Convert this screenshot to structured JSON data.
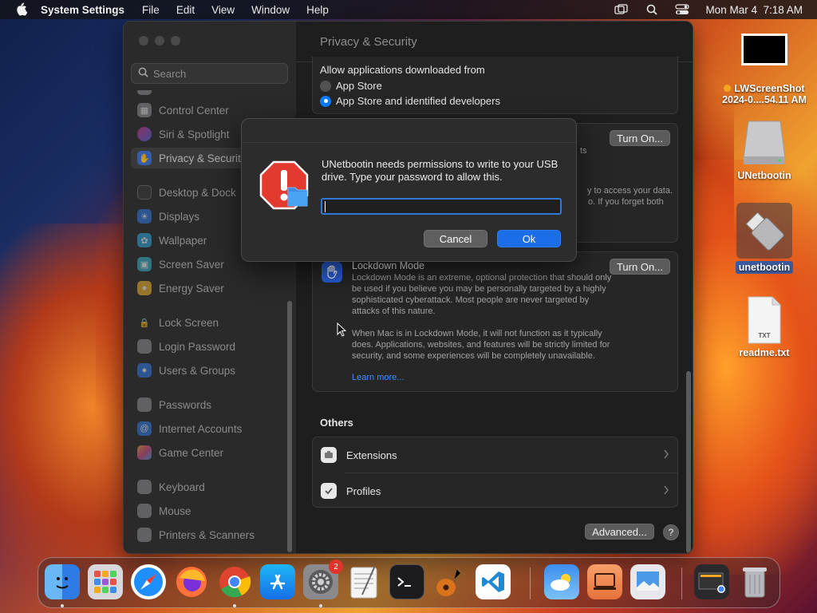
{
  "menubar": {
    "app_name": "System Settings",
    "menus": [
      "File",
      "Edit",
      "View",
      "Window",
      "Help"
    ],
    "clock": "Mon Mar 4  7:18 AM",
    "icons": [
      "apple-icon",
      "screen-mirroring-icon",
      "spotlight-search-icon",
      "control-center-icon"
    ]
  },
  "sidebar": {
    "search_placeholder": "Search",
    "items": [
      {
        "label": "Control Center",
        "icon": "control-center-icon",
        "color": "#8e8e93"
      },
      {
        "label": "Siri & Spotlight",
        "icon": "siri-icon",
        "color": "#c2409a"
      },
      {
        "label": "Privacy & Security",
        "icon": "hand-icon",
        "color": "#3a6fd8"
      },
      {
        "label": "Desktop & Dock",
        "icon": "dock-icon",
        "color": "#2b2b2b"
      },
      {
        "label": "Displays",
        "icon": "displays-icon",
        "color": "#2f7ae5"
      },
      {
        "label": "Wallpaper",
        "icon": "wallpaper-icon",
        "color": "#2fa8d8"
      },
      {
        "label": "Screen Saver",
        "icon": "screen-saver-icon",
        "color": "#37b3c9"
      },
      {
        "label": "Energy Saver",
        "icon": "energy-icon",
        "color": "#f0b32c"
      },
      {
        "label": "Lock Screen",
        "icon": "lock-icon",
        "color": "#2b2b2b"
      },
      {
        "label": "Login Password",
        "icon": "password-icon",
        "color": "#8e8e93"
      },
      {
        "label": "Users & Groups",
        "icon": "users-icon",
        "color": "#2f7ae5"
      },
      {
        "label": "Passwords",
        "icon": "key-icon",
        "color": "#8e8e93"
      },
      {
        "label": "Internet Accounts",
        "icon": "at-icon",
        "color": "#2f7ae5"
      },
      {
        "label": "Game Center",
        "icon": "game-center-icon",
        "color": "#d84d8c"
      },
      {
        "label": "Keyboard",
        "icon": "keyboard-icon",
        "color": "#8e8e93"
      },
      {
        "label": "Mouse",
        "icon": "mouse-icon",
        "color": "#8e8e93"
      },
      {
        "label": "Printers & Scanners",
        "icon": "printer-icon",
        "color": "#8e8e93"
      }
    ]
  },
  "pane": {
    "title": "Privacy & Security",
    "allow_title": "Allow applications downloaded from",
    "radio_app_store": "App Store",
    "radio_identified": "App Store and identified developers",
    "turn_on_label": "Turn On...",
    "faded_right_1": "ts",
    "faded_right_2": "y to access your data.",
    "faded_right_3": "o. If you forget both",
    "lockdown_title": "Lockdown Mode",
    "lockdown_p1": "Lockdown Mode is an extreme, optional protection that should only be used if you believe you may be personally targeted by a highly sophisticated cyberattack. Most people are never targeted by attacks of this nature.",
    "lockdown_p2": "When Mac is in Lockdown Mode, it will not function as it typically does. Applications, websites, and features will be strictly limited for security, and some experiences will be completely unavailable.",
    "learn_more": "Learn more...",
    "others_title": "Others",
    "extensions_label": "Extensions",
    "profiles_label": "Profiles",
    "advanced_label": "Advanced...",
    "help_label": "?"
  },
  "dialog": {
    "message": "UNetbootin needs permissions to write to your USB drive. Type your password to allow this.",
    "password_value": "",
    "cancel_label": "Cancel",
    "ok_label": "Ok"
  },
  "desktop": {
    "screenshot_label_line1": "LWScreenShot",
    "screenshot_label_line2": "2024-0....54.11 AM",
    "drive_label": "UNetbootin",
    "app_label": "unetbootin",
    "readme_label": "readme.txt",
    "readme_tag": "TXT"
  },
  "dock": {
    "settings_badge": "2",
    "apps": [
      "Finder",
      "Launchpad",
      "Safari",
      "Firefox",
      "Chrome",
      "App Store",
      "System Settings",
      "TextEdit",
      "Terminal",
      "GarageBand",
      "Visual Studio Code",
      "Weather",
      "Remote Desktop",
      "Preview",
      "Screenshot",
      "Trash"
    ]
  }
}
